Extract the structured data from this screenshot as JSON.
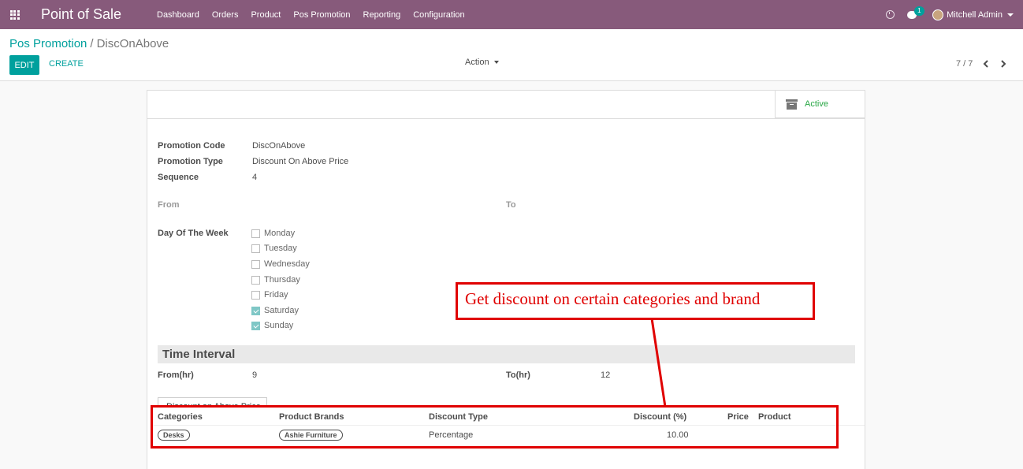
{
  "navbar": {
    "brand": "Point of Sale",
    "menu": [
      "Dashboard",
      "Orders",
      "Product",
      "Pos Promotion",
      "Reporting",
      "Configuration"
    ],
    "chat_badge": "1",
    "user_name": "Mitchell Admin"
  },
  "control_panel": {
    "breadcrumb_parent": "Pos Promotion",
    "breadcrumb_separator": "/",
    "breadcrumb_current": "DiscOnAbove",
    "edit_label": "EDIT",
    "create_label": "CREATE",
    "action_label": "Action",
    "pager": "7 / 7"
  },
  "form": {
    "status_label": "Active",
    "promotion_code_label": "Promotion Code",
    "promotion_code_value": "DiscOnAbove",
    "promotion_type_label": "Promotion Type",
    "promotion_type_value": "Discount On Above Price",
    "sequence_label": "Sequence",
    "sequence_value": "4",
    "from_label": "From",
    "to_label": "To",
    "day_of_week_label": "Day Of The Week",
    "days": [
      {
        "label": "Monday",
        "checked": false
      },
      {
        "label": "Tuesday",
        "checked": false
      },
      {
        "label": "Wednesday",
        "checked": false
      },
      {
        "label": "Thursday",
        "checked": false
      },
      {
        "label": "Friday",
        "checked": false
      },
      {
        "label": "Saturday",
        "checked": true
      },
      {
        "label": "Sunday",
        "checked": true
      }
    ],
    "time_interval_title": "Time Interval",
    "from_hr_label": "From(hr)",
    "from_hr_value": "9",
    "to_hr_label": "To(hr)",
    "to_hr_value": "12",
    "tab_label": "Discount on Above Price",
    "table": {
      "headers": [
        "Categories",
        "Product Brands",
        "Discount Type",
        "Discount (%)",
        "Price",
        "Product"
      ],
      "row": {
        "category": "Desks",
        "brand": "Ashie Furniture",
        "discount_type": "Percentage",
        "discount": "10.00"
      }
    }
  },
  "annotation": {
    "text": "Get discount on certain categories and brand",
    "color": "#e00000"
  },
  "colors": {
    "navbar": "#875a7b",
    "primary": "#00a09d",
    "active": "#28a745"
  }
}
